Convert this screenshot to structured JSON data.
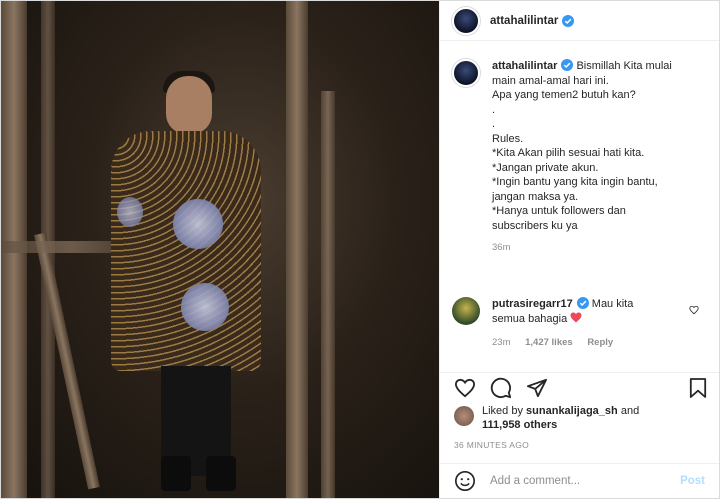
{
  "post": {
    "username": "attahalilintar",
    "caption_lines": [
      "Bismillah Kita mulai",
      "main amal-amal hari ini.",
      "Apa yang temen2 butuh kan?",
      ".",
      ".",
      "Rules.",
      "*Kita Akan pilih sesuai hati kita.",
      "*Jangan private akun.",
      "*Ingin bantu yang kita ingin bantu,",
      "jangan maksa ya.",
      "*Hanya untuk followers dan",
      "subscribers ku ya"
    ],
    "caption_age": "36m"
  },
  "comment": {
    "username": "putrasiregarr17",
    "text_line1": "Mau kita",
    "text_line2": "semua bahagia",
    "age": "23m",
    "likes": "1,427 likes",
    "reply": "Reply"
  },
  "likes": {
    "prefix": "Liked by",
    "user": "sunankalijaga_sh",
    "joiner": "and",
    "others": "111,958 others"
  },
  "timestamp": "36 MINUTES AGO",
  "add_comment": {
    "placeholder": "Add a comment...",
    "post_label": "Post"
  },
  "colors": {
    "verified": "#3897f0",
    "heart": "#ed4956",
    "post_disabled": "#b2dffc"
  },
  "icons": [
    "verified-badge-icon",
    "heart-icon",
    "comment-icon",
    "share-icon",
    "bookmark-icon",
    "emoji-icon"
  ]
}
